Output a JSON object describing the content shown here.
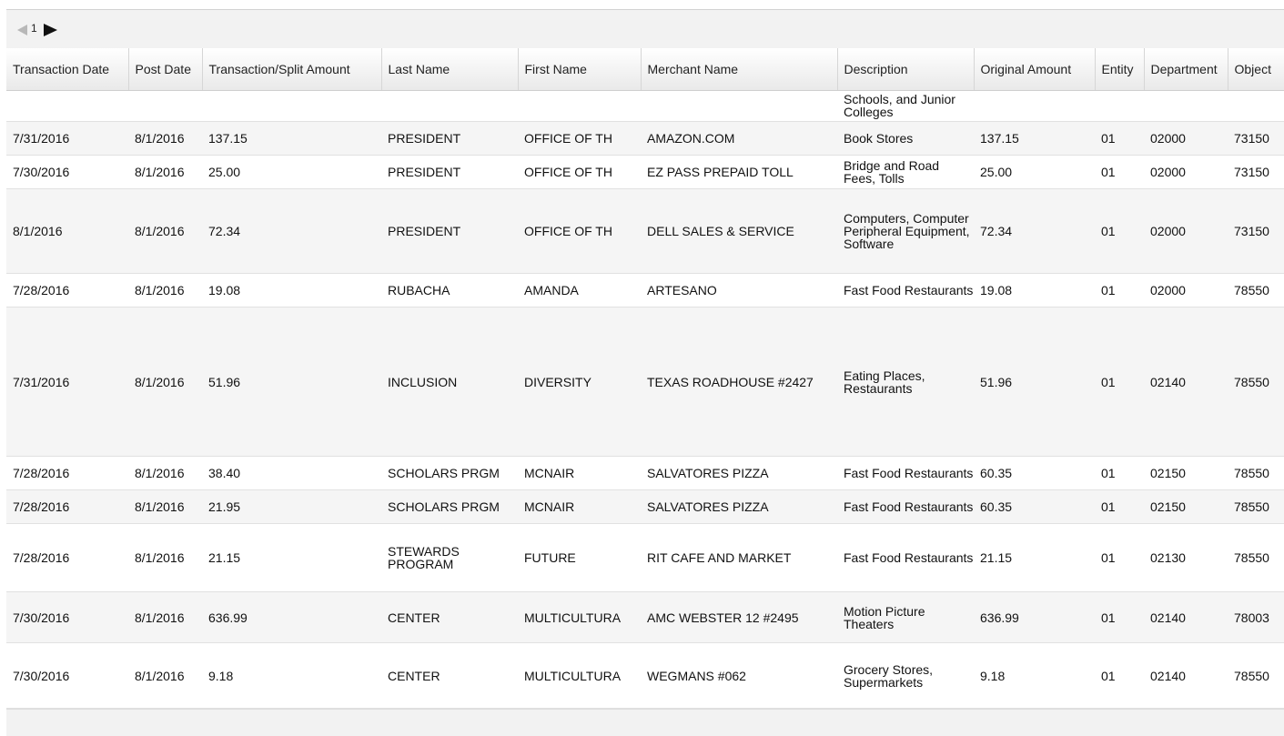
{
  "pager": {
    "page": "1"
  },
  "columns": [
    "Transaction Date",
    "Post Date",
    "Transaction/Split Amount",
    "Last Name",
    "First Name",
    "Merchant Name",
    "Description",
    "Original Amount",
    "Entity",
    "Department",
    "Object"
  ],
  "partial_row": {
    "description": "Schools, and Junior Colleges"
  },
  "rows": [
    {
      "transaction_date": "7/31/2016",
      "post_date": "8/1/2016",
      "amount": "137.15",
      "last_name": "PRESIDENT",
      "first_name": "OFFICE OF TH",
      "merchant": "AMAZON.COM",
      "description": "Book Stores",
      "original_amount": "137.15",
      "entity": "01",
      "department": "02000",
      "object": "73150"
    },
    {
      "transaction_date": "7/30/2016",
      "post_date": "8/1/2016",
      "amount": "25.00",
      "last_name": "PRESIDENT",
      "first_name": "OFFICE OF TH",
      "merchant": "EZ PASS PREPAID TOLL",
      "description": "Bridge and Road Fees, Tolls",
      "original_amount": "25.00",
      "entity": "01",
      "department": "02000",
      "object": "73150"
    },
    {
      "transaction_date": "8/1/2016",
      "post_date": "8/1/2016",
      "amount": "72.34",
      "last_name": "PRESIDENT",
      "first_name": "OFFICE OF TH",
      "merchant": "DELL SALES & SERVICE",
      "description": "Computers, Computer Peripheral Equipment, Software",
      "original_amount": "72.34",
      "entity": "01",
      "department": "02000",
      "object": "73150"
    },
    {
      "transaction_date": "7/28/2016",
      "post_date": "8/1/2016",
      "amount": "19.08",
      "last_name": "RUBACHA",
      "first_name": "AMANDA",
      "merchant": "ARTESANO",
      "description": "Fast Food Restaurants",
      "original_amount": "19.08",
      "entity": "01",
      "department": "02000",
      "object": "78550"
    },
    {
      "transaction_date": "7/31/2016",
      "post_date": "8/1/2016",
      "amount": "51.96",
      "last_name": "INCLUSION",
      "first_name": "DIVERSITY",
      "merchant": "TEXAS ROADHOUSE #2427",
      "description": "Eating Places, Restaurants",
      "original_amount": "51.96",
      "entity": "01",
      "department": "02140",
      "object": "78550"
    },
    {
      "transaction_date": "7/28/2016",
      "post_date": "8/1/2016",
      "amount": "38.40",
      "last_name": "SCHOLARS PRGM",
      "first_name": "MCNAIR",
      "merchant": "SALVATORES PIZZA",
      "description": "Fast Food Restaurants",
      "original_amount": "60.35",
      "entity": "01",
      "department": "02150",
      "object": "78550"
    },
    {
      "transaction_date": "7/28/2016",
      "post_date": "8/1/2016",
      "amount": "21.95",
      "last_name": "SCHOLARS PRGM",
      "first_name": "MCNAIR",
      "merchant": "SALVATORES PIZZA",
      "description": "Fast Food Restaurants",
      "original_amount": "60.35",
      "entity": "01",
      "department": "02150",
      "object": "78550"
    },
    {
      "transaction_date": "7/28/2016",
      "post_date": "8/1/2016",
      "amount": "21.15",
      "last_name": "STEWARDS PROGRAM",
      "first_name": "FUTURE",
      "merchant": "RIT CAFE AND MARKET",
      "description": "Fast Food Restaurants",
      "original_amount": "21.15",
      "entity": "01",
      "department": "02130",
      "object": "78550"
    },
    {
      "transaction_date": "7/30/2016",
      "post_date": "8/1/2016",
      "amount": "636.99",
      "last_name": "CENTER",
      "first_name": "MULTICULTURA",
      "merchant": "AMC WEBSTER 12 #2495",
      "description": "Motion Picture Theaters",
      "original_amount": "636.99",
      "entity": "01",
      "department": "02140",
      "object": "78003"
    },
    {
      "transaction_date": "7/30/2016",
      "post_date": "8/1/2016",
      "amount": "9.18",
      "last_name": "CENTER",
      "first_name": "MULTICULTURA",
      "merchant": "WEGMANS #062",
      "description": "Grocery Stores, Supermarkets",
      "original_amount": "9.18",
      "entity": "01",
      "department": "02140",
      "object": "78550"
    }
  ]
}
